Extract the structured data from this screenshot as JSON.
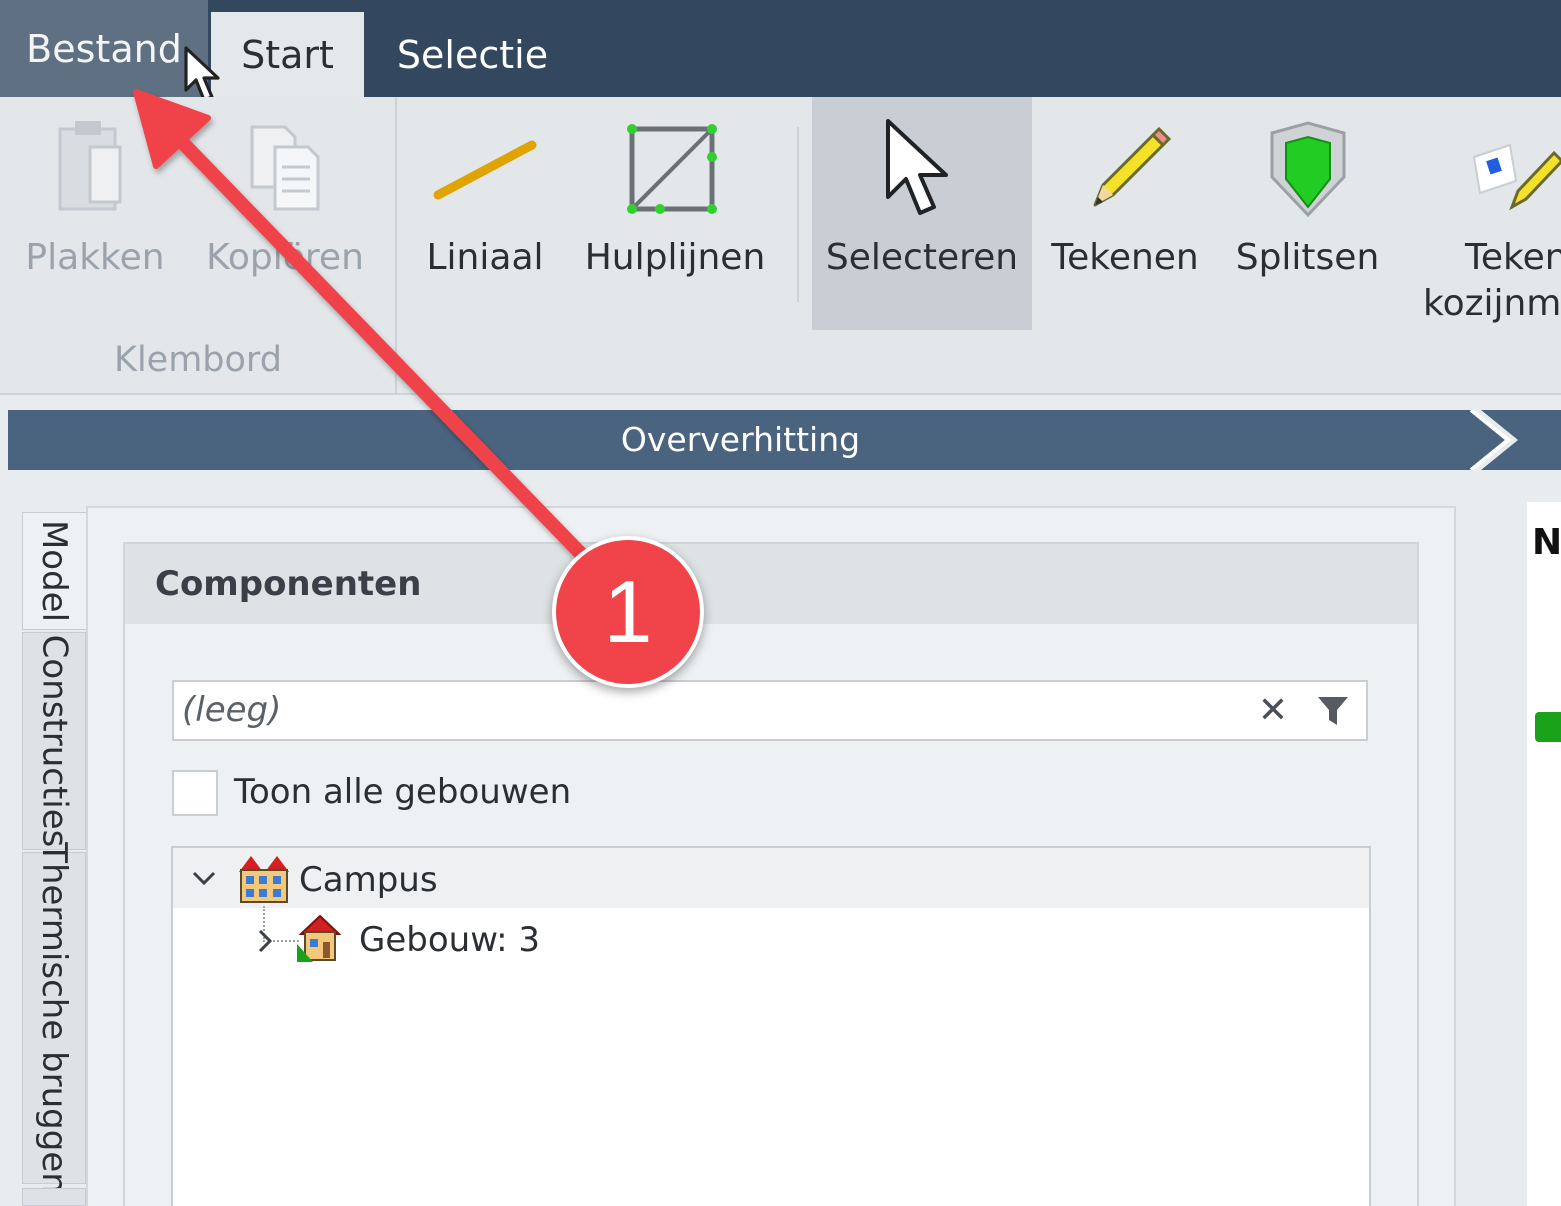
{
  "tabs": {
    "file": "Bestand",
    "start": "Start",
    "selection": "Selectie"
  },
  "ribbon": {
    "clipboard": {
      "paste": "Plakken",
      "copy": "Kopiëren",
      "group_label": "Klembord"
    },
    "tools": {
      "ruler": "Liniaal",
      "guides": "Hulplijnen",
      "select": "Selecteren",
      "draw": "Tekenen",
      "split": "Splitsen",
      "draw_frame_line1": "Teken",
      "draw_frame_line2": "kozijnm"
    }
  },
  "step": {
    "label": "Oververhitting"
  },
  "side_tabs": [
    "Model",
    "Constructies",
    "Thermische bruggen"
  ],
  "components": {
    "title": "Componenten",
    "search_placeholder": "(leeg)",
    "show_all_label": "Toon alle gebouwen",
    "tree": {
      "root": "Campus",
      "child": "Gebouw: 3"
    }
  },
  "right_panel": {
    "header_partial": "N"
  },
  "annotation": {
    "step_number": "1"
  },
  "colors": {
    "title_bar": "#33475e",
    "step_bar": "#4a6480",
    "annotation_red": "#f0434a"
  },
  "icons": {
    "paste": "paste-icon",
    "copy": "copy-icon",
    "ruler": "ruler-icon",
    "guides": "guides-icon",
    "select": "cursor-arrow-icon",
    "draw": "pencil-icon",
    "split": "split-shield-icon",
    "draw_frame": "draw-frame-icon",
    "clear": "close-icon",
    "filter": "filter-icon",
    "campus": "campus-building-icon",
    "building": "house-icon",
    "expand": "chevron-down-icon",
    "collapse": "chevron-right-icon"
  }
}
